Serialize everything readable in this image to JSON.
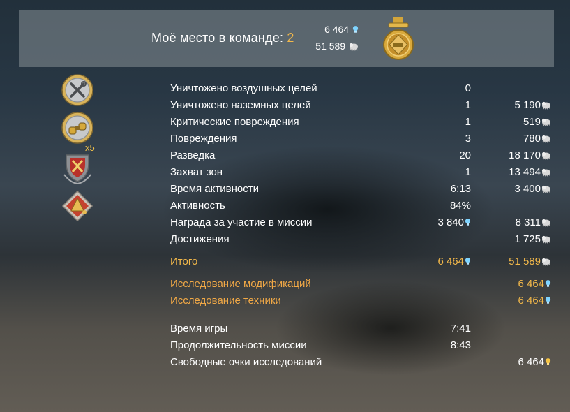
{
  "header": {
    "place_label": "Моё место в команде:",
    "place_value": "2",
    "rp_value": "6 464",
    "sl_value": "51 589"
  },
  "badges": {
    "multiplier": "x5"
  },
  "stats": [
    {
      "label": "Уничтожено воздушных целей",
      "v1": "0",
      "v2": ""
    },
    {
      "label": "Уничтожено наземных целей",
      "v1": "1",
      "v2": "5 190"
    },
    {
      "label": "Критические повреждения",
      "v1": "1",
      "v2": "519"
    },
    {
      "label": "Повреждения",
      "v1": "3",
      "v2": "780"
    },
    {
      "label": "Разведка",
      "v1": "20",
      "v2": "18 170"
    },
    {
      "label": "Захват зон",
      "v1": "1",
      "v2": "13 494"
    },
    {
      "label": "Время активности",
      "v1": "6:13",
      "v2": "3 400"
    },
    {
      "label": "Активность",
      "v1": "84%",
      "v2": ""
    },
    {
      "label": "Награда за участие в миссии",
      "v1": "3 840",
      "v2": "8 311"
    },
    {
      "label": "Достижения",
      "v1": "",
      "v2": "1 725"
    }
  ],
  "total": {
    "label": "Итого",
    "v1": "6 464",
    "v2": "51 589"
  },
  "research": [
    {
      "label": "Исследование модификаций",
      "value": "6 464"
    },
    {
      "label": "Исследование техники",
      "value": "6 464"
    }
  ],
  "info": [
    {
      "label": "Время игры",
      "value": "7:41"
    },
    {
      "label": "Продолжительность миссии",
      "value": "8:43"
    },
    {
      "label": "Свободные очки исследований",
      "value": "6 464"
    }
  ],
  "colors": {
    "gold": "#f2b84a",
    "rp_icon": "#7fd4ff",
    "sl_icon": "#d9d9d9",
    "free_rp_icon": "#f6c443"
  },
  "icons": [
    "repair-tools-icon",
    "binoculars-icon",
    "crossed-swords-shield-icon",
    "artillery-shell-icon",
    "medal-icon",
    "research-bulb-icon",
    "silver-lions-icon"
  ]
}
